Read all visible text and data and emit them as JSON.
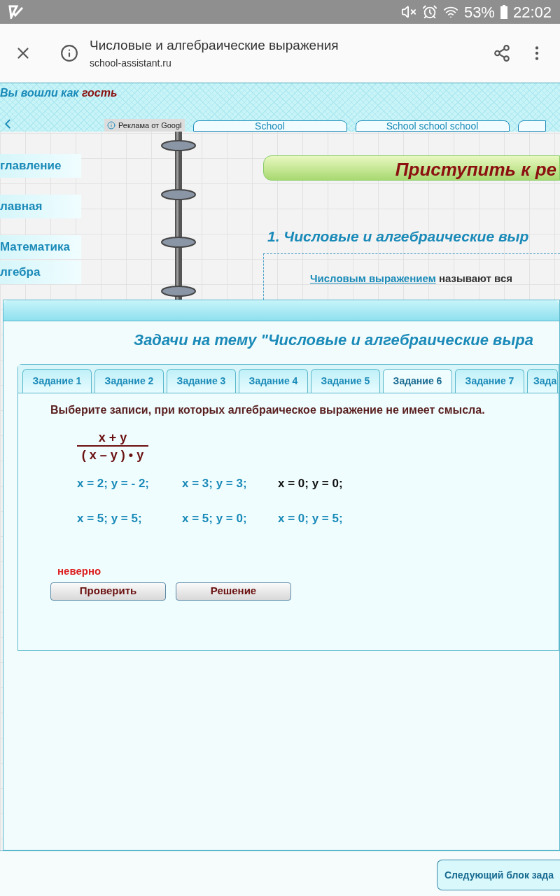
{
  "status_bar": {
    "battery": "53%",
    "time": "22:02"
  },
  "browser": {
    "title": "Числовые и алгебраические выражения",
    "url": "school-assistant.ru"
  },
  "top_band": {
    "login_label": "Вы вошли как",
    "user": "гость",
    "ad_label": "Реклама от Googl",
    "nav_tabs": [
      "School",
      "School school school"
    ]
  },
  "sidebar": {
    "items": [
      "главление",
      "лавная",
      "Математика",
      "лгебра"
    ]
  },
  "content": {
    "start_button": "Приступить к ре",
    "heading": "1. Числовые и алгебраические выр",
    "definition": {
      "term": "Числовым выражением",
      "text": "называют вся"
    }
  },
  "task_panel": {
    "title": "Задачи на тему \"Числовые и алгебраические выра",
    "tabs": [
      {
        "label": "Задание 1",
        "selected": false
      },
      {
        "label": "Задание 2",
        "selected": false
      },
      {
        "label": "Задание 3",
        "selected": false
      },
      {
        "label": "Задание 4",
        "selected": false
      },
      {
        "label": "Задание 5",
        "selected": false
      },
      {
        "label": "Задание 6",
        "selected": true
      },
      {
        "label": "Задание 7",
        "selected": false
      },
      {
        "label": "Зада",
        "selected": false
      }
    ],
    "question": "Выберите записи, при которых алгебраическое выражение не имеет смысла.",
    "fraction": {
      "numerator": "x + y",
      "denominator": "( x – y ) • y"
    },
    "options": [
      {
        "label": "x = 2; y = - 2;",
        "selected": false
      },
      {
        "label": "x = 3; y = 3;",
        "selected": false
      },
      {
        "label": "x = 0; y = 0;",
        "selected": true
      },
      {
        "label": "x = 5; y = 5;",
        "selected": false
      },
      {
        "label": "x = 5; y = 0;",
        "selected": false
      },
      {
        "label": "x = 0; y = 5;",
        "selected": false
      }
    ],
    "feedback": "неверно",
    "buttons": [
      "Проверить",
      "Решение"
    ]
  },
  "next_button": "Следующий блок зада"
}
